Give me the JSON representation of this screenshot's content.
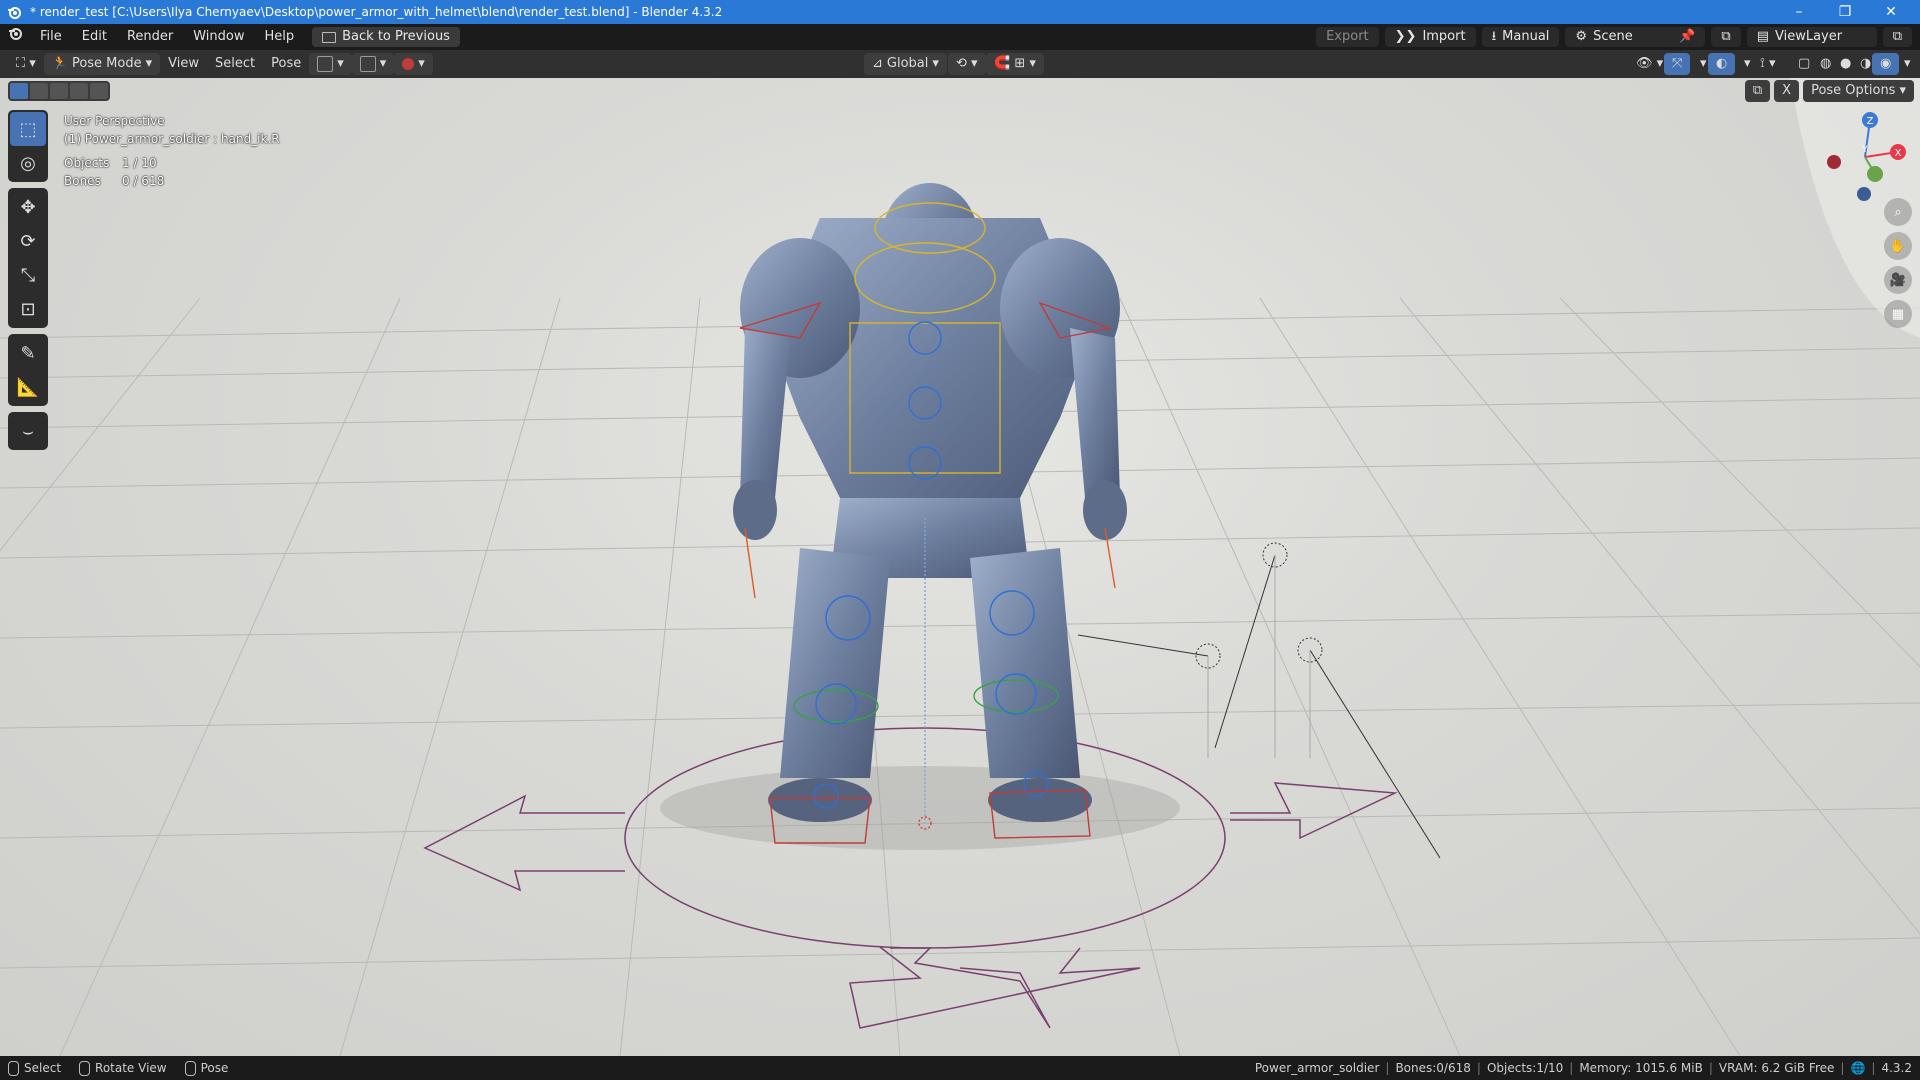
{
  "window": {
    "title": "* render_test [C:\\Users\\Ilya Chernyaev\\Desktop\\power_armor_with_helmet\\blend\\render_test.blend] - Blender 4.3.2",
    "minimize": "–",
    "maximize": "❐",
    "close": "✕"
  },
  "menubar": {
    "items": [
      "File",
      "Edit",
      "Render",
      "Window",
      "Help"
    ],
    "back_button": "Back to Previous",
    "export": "Export",
    "import": "Import",
    "manual": "Manual",
    "scene": "Scene",
    "view_layer": "ViewLayer"
  },
  "viewport_header": {
    "mode": "Pose Mode",
    "menus": [
      "View",
      "Select",
      "Pose"
    ],
    "orientation": "Global",
    "pose_options": "Pose Options",
    "x_label": "X"
  },
  "overlay": {
    "view_name": "User Perspective",
    "active_object": "(1) Power_armor_soldier : hand_ik.R",
    "objects_label": "Objects",
    "objects_value": "1 / 10",
    "bones_label": "Bones",
    "bones_value": "0 / 618"
  },
  "gizmo": {
    "z": "Z",
    "y": "Y",
    "x": "X",
    "colors": {
      "x": "#e8394a",
      "y": "#6aa34a",
      "z": "#3f79d6"
    }
  },
  "statusbar": {
    "select": "Select",
    "rotate_view": "Rotate View",
    "pose": "Pose",
    "object_name": "Power_armor_soldier",
    "bones": "Bones:0/618",
    "objects": "Objects:1/10",
    "memory": "Memory: 1015.6 MiB",
    "vram": "VRAM: 6.2 GiB Free",
    "version": "4.3.2"
  },
  "colors": {
    "accent": "#4772b3",
    "titlebar": "#2b79d6"
  }
}
